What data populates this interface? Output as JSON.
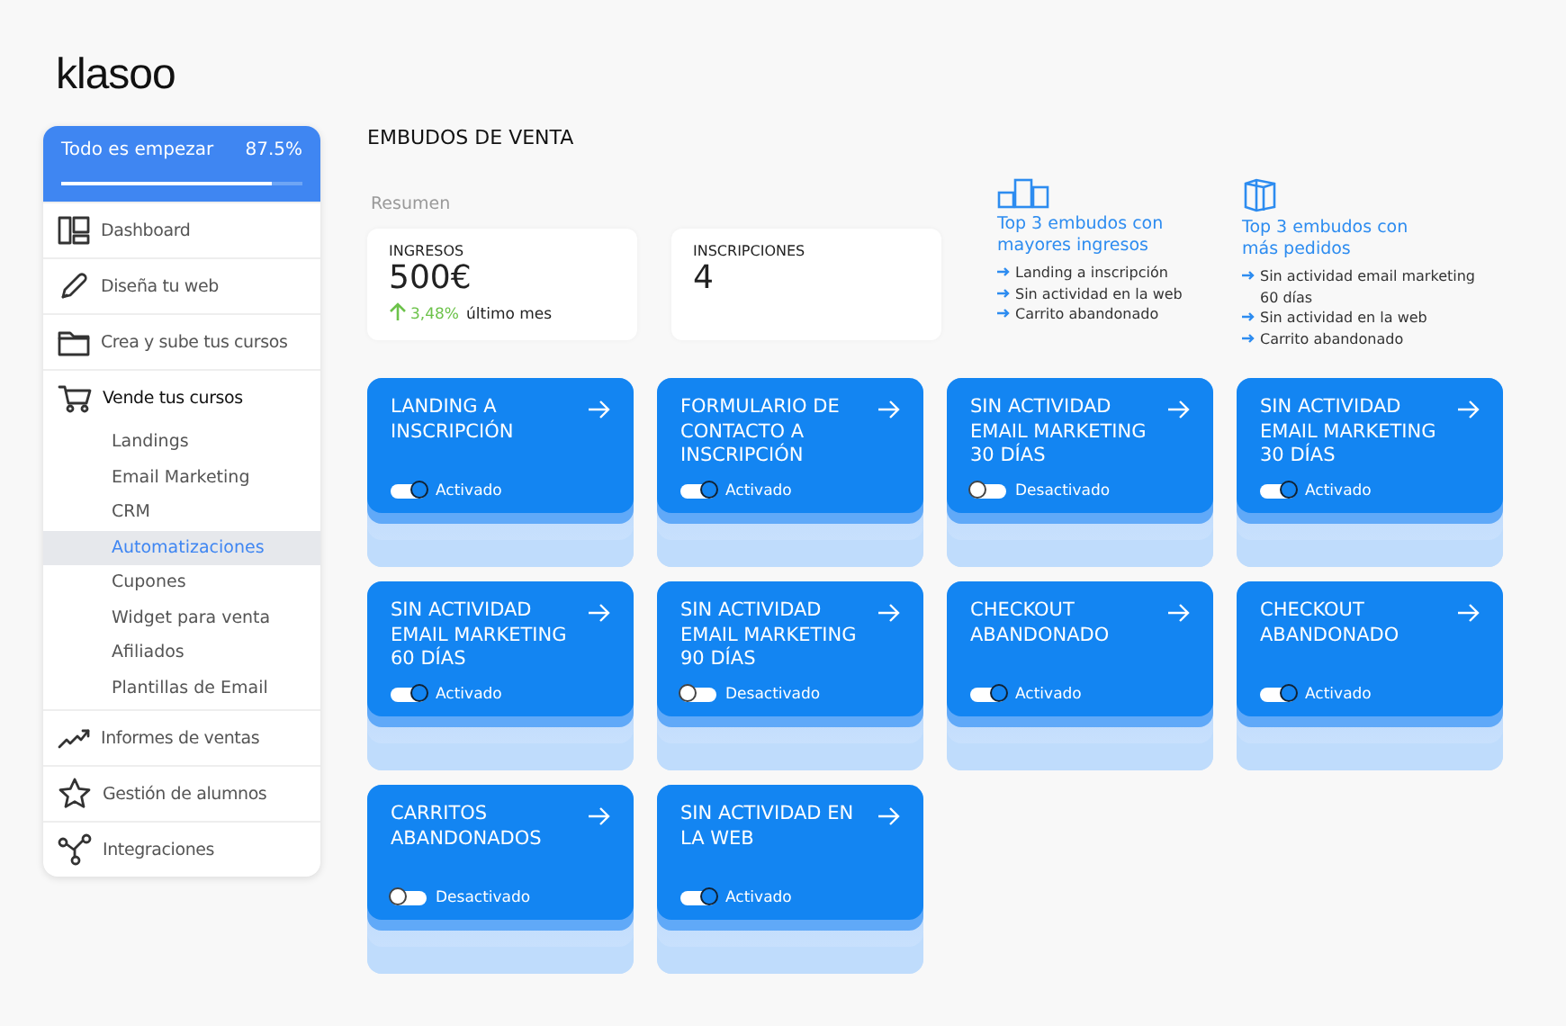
{
  "logo": "klasoo",
  "progress": {
    "label": "Todo es empezar",
    "reading": "87.5%",
    "level": 0.875
  },
  "nav": [
    {
      "label": "Dashboard",
      "expanded": false
    },
    {
      "label": "Diseña tu web",
      "expanded": false
    },
    {
      "label": "Crea y sube tus cursos",
      "expanded": false
    },
    {
      "label": "Vende tus cursos",
      "expanded": true,
      "children": [
        {
          "label": "Landings",
          "selected": false
        },
        {
          "label": "Email Marketing",
          "selected": false
        },
        {
          "label": "CRM",
          "selected": false
        },
        {
          "label": "Automatizaciones",
          "selected": true
        },
        {
          "label": "Cupones",
          "selected": false
        },
        {
          "label": "Widget para venta",
          "selected": false
        },
        {
          "label": "Afiliados",
          "selected": false
        },
        {
          "label": "Plantillas de Email",
          "selected": false
        }
      ]
    },
    {
      "label": "Informes de ventas",
      "expanded": false
    },
    {
      "label": "Gestión de alumnos",
      "expanded": false
    },
    {
      "label": "Integraciones",
      "expanded": false
    }
  ],
  "page_title": "EMBUDOS DE VENTA",
  "summary_label": "Resumen",
  "stats": [
    {
      "label": "INGRESOS",
      "value": "500€",
      "change": "3,48%",
      "change_note": "último mes"
    },
    {
      "label": "INSCRIPCIONES",
      "value": "4"
    }
  ],
  "tops": [
    {
      "title": "Top 3 embudos con mayores ingresos",
      "items": [
        "Landing a inscripción",
        "Sin actividad en la web",
        "Carrito abandonado"
      ]
    },
    {
      "title": "Top 3 embudos con más pedidos",
      "items": [
        "Sin actividad email marketing 60 días",
        "Sin actividad en la web",
        "Carrito abandonado"
      ]
    }
  ],
  "funnels": [
    {
      "title": "LANDING A INSCRIPCIÓN",
      "on": true,
      "status": "Activado"
    },
    {
      "title": "FORMULARIO DE CONTACTO A INSCRIPCIÓN",
      "on": true,
      "status": "Activado"
    },
    {
      "title": "SIN ACTIVIDAD EMAIL MARKETING 30 DÍAS",
      "on": false,
      "status": "Desactivado"
    },
    {
      "title": "SIN ACTIVIDAD EMAIL MARKETING 30 DÍAS",
      "on": true,
      "status": "Activado"
    },
    {
      "title": "SIN ACTIVIDAD EMAIL MARKETING 60 DÍAS",
      "on": true,
      "status": "Activado"
    },
    {
      "title": "SIN ACTIVIDAD EMAIL MARKETING 90 DÍAS",
      "on": false,
      "status": "Desactivado"
    },
    {
      "title": "CHECKOUT ABANDONADO",
      "on": true,
      "status": "Activado"
    },
    {
      "title": "CHECKOUT ABANDONADO",
      "on": true,
      "status": "Activado"
    },
    {
      "title": "CARRITOS ABANDONADOS",
      "on": false,
      "status": "Desactivado"
    },
    {
      "title": "SIN ACTIVIDAD EN LA WEB",
      "on": true,
      "status": "Activado"
    }
  ]
}
